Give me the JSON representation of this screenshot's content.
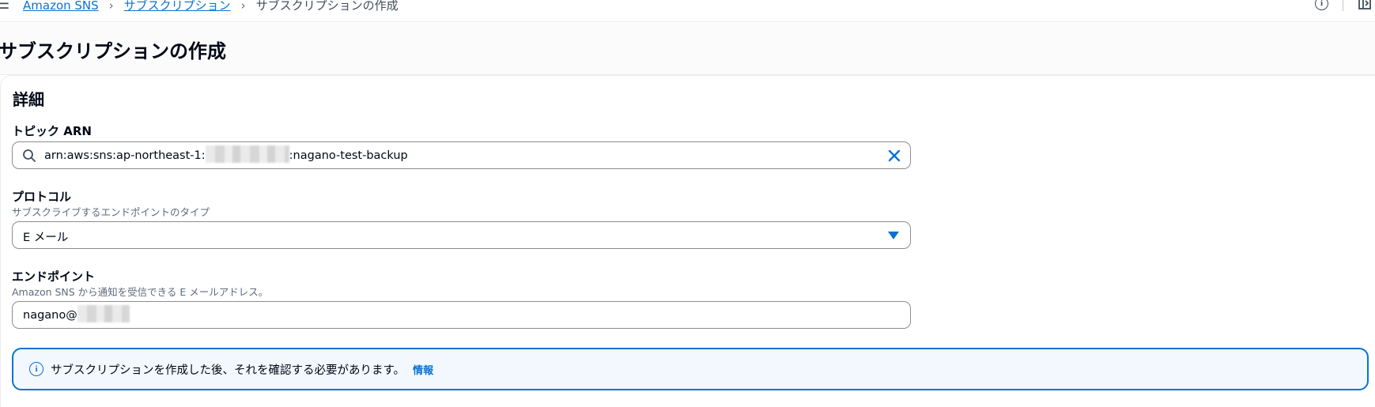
{
  "breadcrumb": {
    "items": [
      {
        "label": "Amazon SNS"
      },
      {
        "label": "サブスクリプション"
      }
    ],
    "current": "サブスクリプションの作成"
  },
  "header": {
    "title": "サブスクリプションの作成"
  },
  "details": {
    "title": "詳細",
    "topic_arn": {
      "label": "トピック ARN",
      "value_prefix": "arn:aws:sns:ap-northeast-1:",
      "value_suffix": ":nagano-test-backup"
    },
    "protocol": {
      "label": "プロトコル",
      "description": "サブスクライブするエンドポイントのタイプ",
      "selected": "E メール"
    },
    "endpoint": {
      "label": "エンドポイント",
      "description": "Amazon SNS から通知を受信できる E メールアドレス。",
      "value_prefix": "nagano@"
    }
  },
  "alert": {
    "message": "サブスクリプションを作成した後、それを確認する必要があります。",
    "link": "情報"
  },
  "colors": {
    "link": "#0972d3",
    "text": "#000716",
    "secondary_text": "#5f6b7a",
    "alert_background": "#f2f8fd",
    "border": "#8c8c94"
  },
  "icons": {
    "menu": "hamburger-menu-icon",
    "info": "info-icon",
    "panel": "panel-toggle-icon",
    "search": "search-icon",
    "clear": "close-icon",
    "dropdown": "caret-down-icon"
  }
}
